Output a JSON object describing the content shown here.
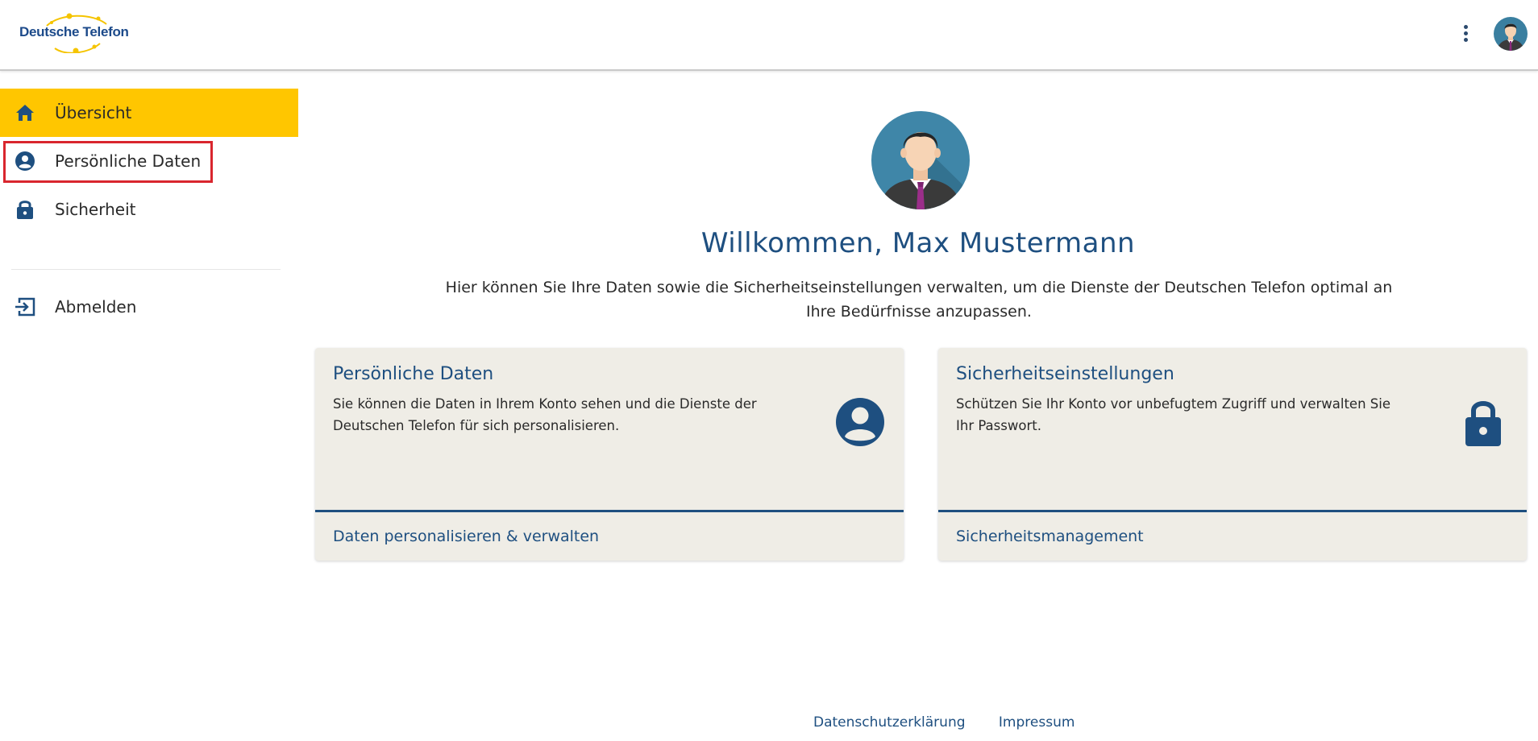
{
  "header": {
    "logo_text": "Deutsche Telefon",
    "menu_icon": "more-vert-icon",
    "avatar_icon": "user-avatar-icon"
  },
  "sidebar": {
    "items": [
      {
        "label": "Übersicht",
        "icon": "home-icon",
        "active": true
      },
      {
        "label": "Persönliche Daten",
        "icon": "account-circle-icon",
        "active": false,
        "highlighted": true
      },
      {
        "label": "Sicherheit",
        "icon": "lock-icon",
        "active": false
      }
    ],
    "logout": {
      "label": "Abmelden",
      "icon": "logout-icon"
    }
  },
  "main": {
    "welcome": "Willkommen, Max Mustermann",
    "intro": "Hier können Sie Ihre Daten sowie die Sicherheitseinstellungen verwalten, um die Dienste der Deutschen Telefon optimal an Ihre Bedürfnisse anzupassen.",
    "cards": [
      {
        "title": "Persönliche Daten",
        "text": "Sie können die Daten in Ihrem Konto sehen und die Dienste der Deutschen Telefon für sich personalisieren.",
        "link": "Daten personalisieren & verwalten",
        "icon": "account-circle-icon"
      },
      {
        "title": "Sicherheitseinstellungen",
        "text": "Schützen Sie Ihr Konto vor unbefugtem Zugriff und verwalten Sie Ihr Passwort.",
        "link": "Sicherheitsmanagement",
        "icon": "lock-icon"
      }
    ]
  },
  "footer": {
    "privacy": "Datenschutzerklärung",
    "imprint": "Impressum"
  },
  "colors": {
    "accent": "#ffc600",
    "primary": "#1e4f80",
    "card_bg": "#efede6",
    "highlight": "#d9262e"
  }
}
